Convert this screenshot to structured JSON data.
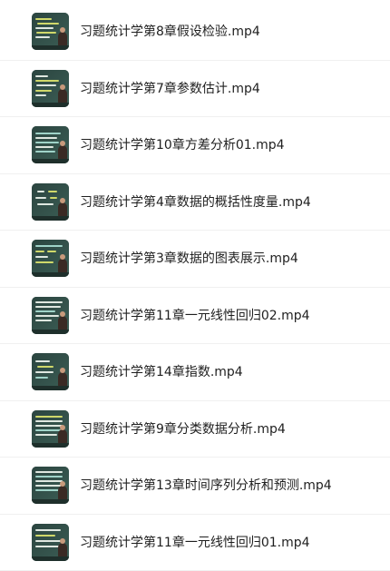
{
  "files": [
    {
      "name": "习题统计学第8章假设检验.mp4",
      "thumbnail_icon": "video-thumbnail-icon"
    },
    {
      "name": "习题统计学第7章参数估计.mp4",
      "thumbnail_icon": "video-thumbnail-icon"
    },
    {
      "name": "习题统计学第10章方差分析01.mp4",
      "thumbnail_icon": "video-thumbnail-icon"
    },
    {
      "name": "习题统计学第4章数据的概括性度量.mp4",
      "thumbnail_icon": "video-thumbnail-icon"
    },
    {
      "name": "习题统计学第3章数据的图表展示.mp4",
      "thumbnail_icon": "video-thumbnail-icon"
    },
    {
      "name": "习题统计学第11章一元线性回归02.mp4",
      "thumbnail_icon": "video-thumbnail-icon"
    },
    {
      "name": "习题统计学第14章指数.mp4",
      "thumbnail_icon": "video-thumbnail-icon"
    },
    {
      "name": "习题统计学第9章分类数据分析.mp4",
      "thumbnail_icon": "video-thumbnail-icon"
    },
    {
      "name": "习题统计学第13章时间序列分析和预测.mp4",
      "thumbnail_icon": "video-thumbnail-icon"
    },
    {
      "name": "习题统计学第11章一元线性回归01.mp4",
      "thumbnail_icon": "video-thumbnail-icon"
    }
  ],
  "colors": {
    "text": "#1f1f1f",
    "divider": "#f0f0f0",
    "background": "#ffffff",
    "blackboard": "#2f4a44"
  }
}
